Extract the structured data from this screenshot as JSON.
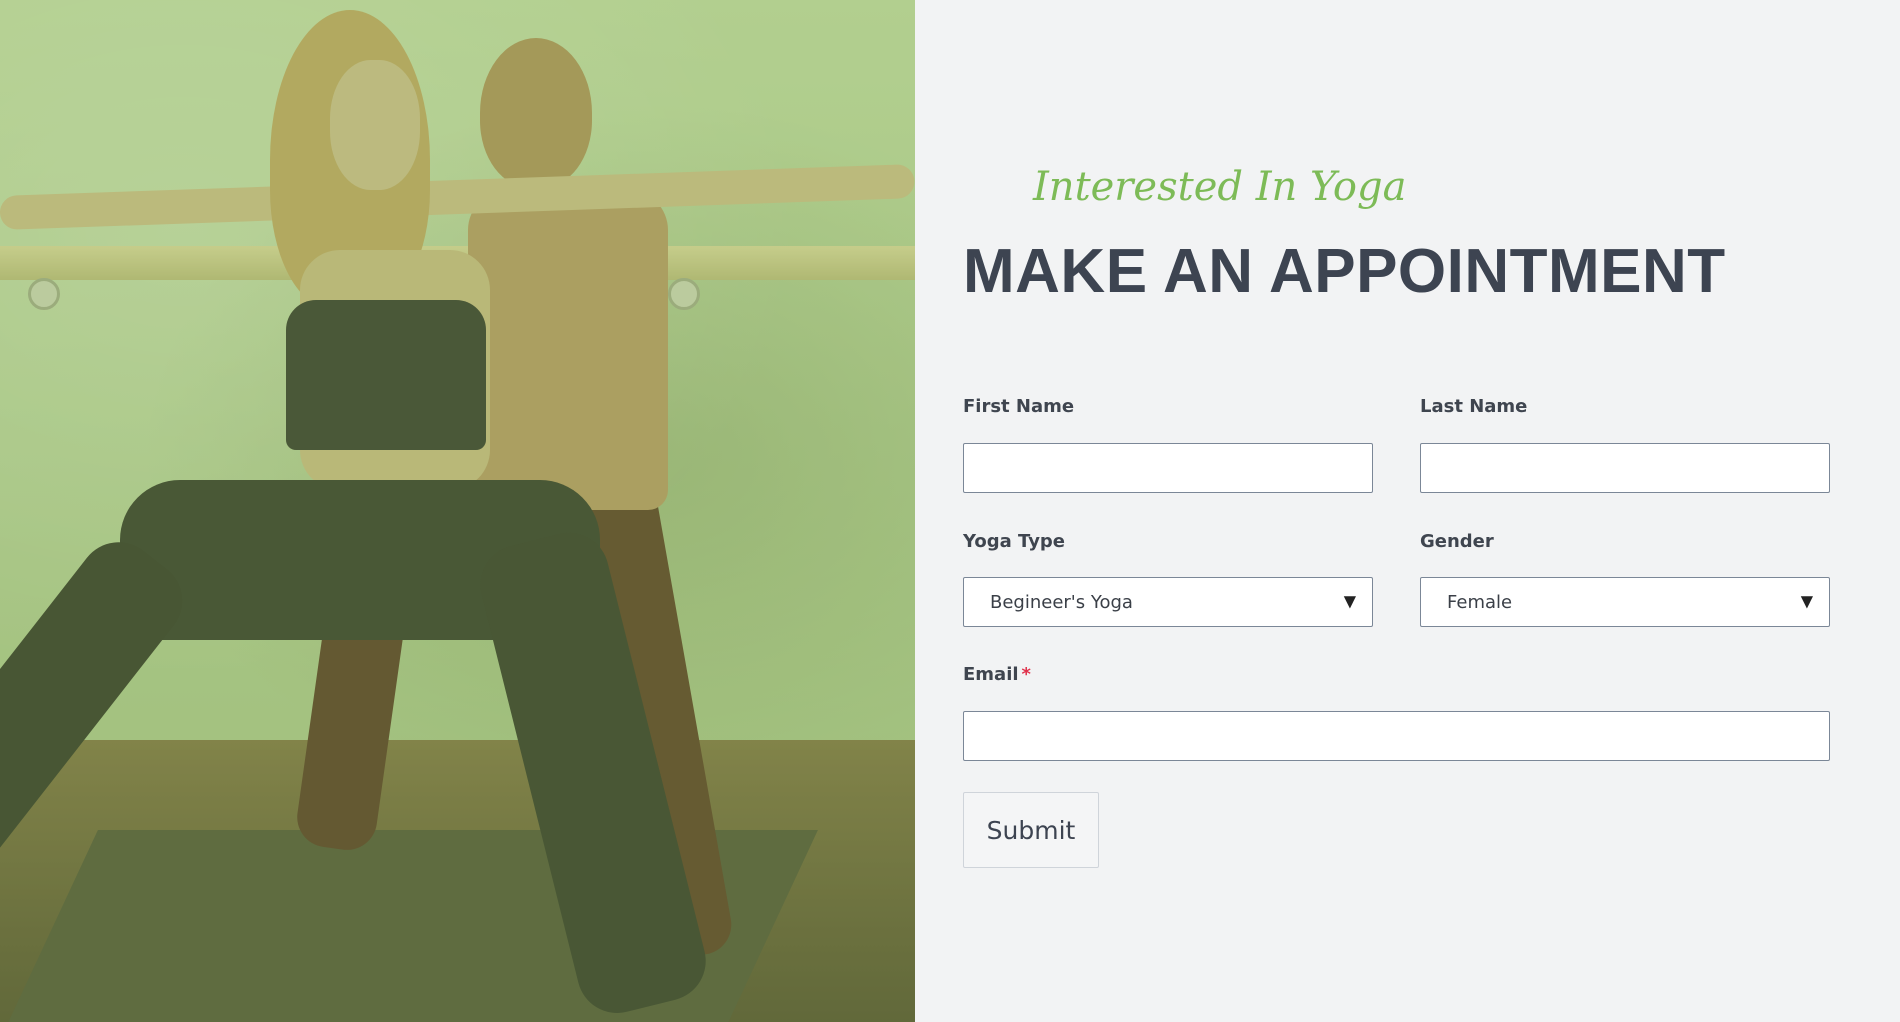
{
  "hero": {
    "image": "yoga-instructor-adjusting-pose-photo",
    "overlay_color": "#96be64"
  },
  "form": {
    "eyebrow": "Interested In Yoga",
    "title": "MAKE AN APPOINTMENT",
    "first_name": {
      "label": "First Name",
      "value": ""
    },
    "last_name": {
      "label": "Last Name",
      "value": ""
    },
    "yoga_type": {
      "label": "Yoga Type",
      "selected": "Begineer's Yoga"
    },
    "gender": {
      "label": "Gender",
      "selected": "Female"
    },
    "email": {
      "label": "Email",
      "required_mark": "*",
      "value": ""
    },
    "submit_label": "Submit"
  },
  "colors": {
    "accent": "#7dbb57",
    "heading": "#3d4451",
    "required": "#e0304a",
    "panel_bg": "#f2f3f4"
  }
}
